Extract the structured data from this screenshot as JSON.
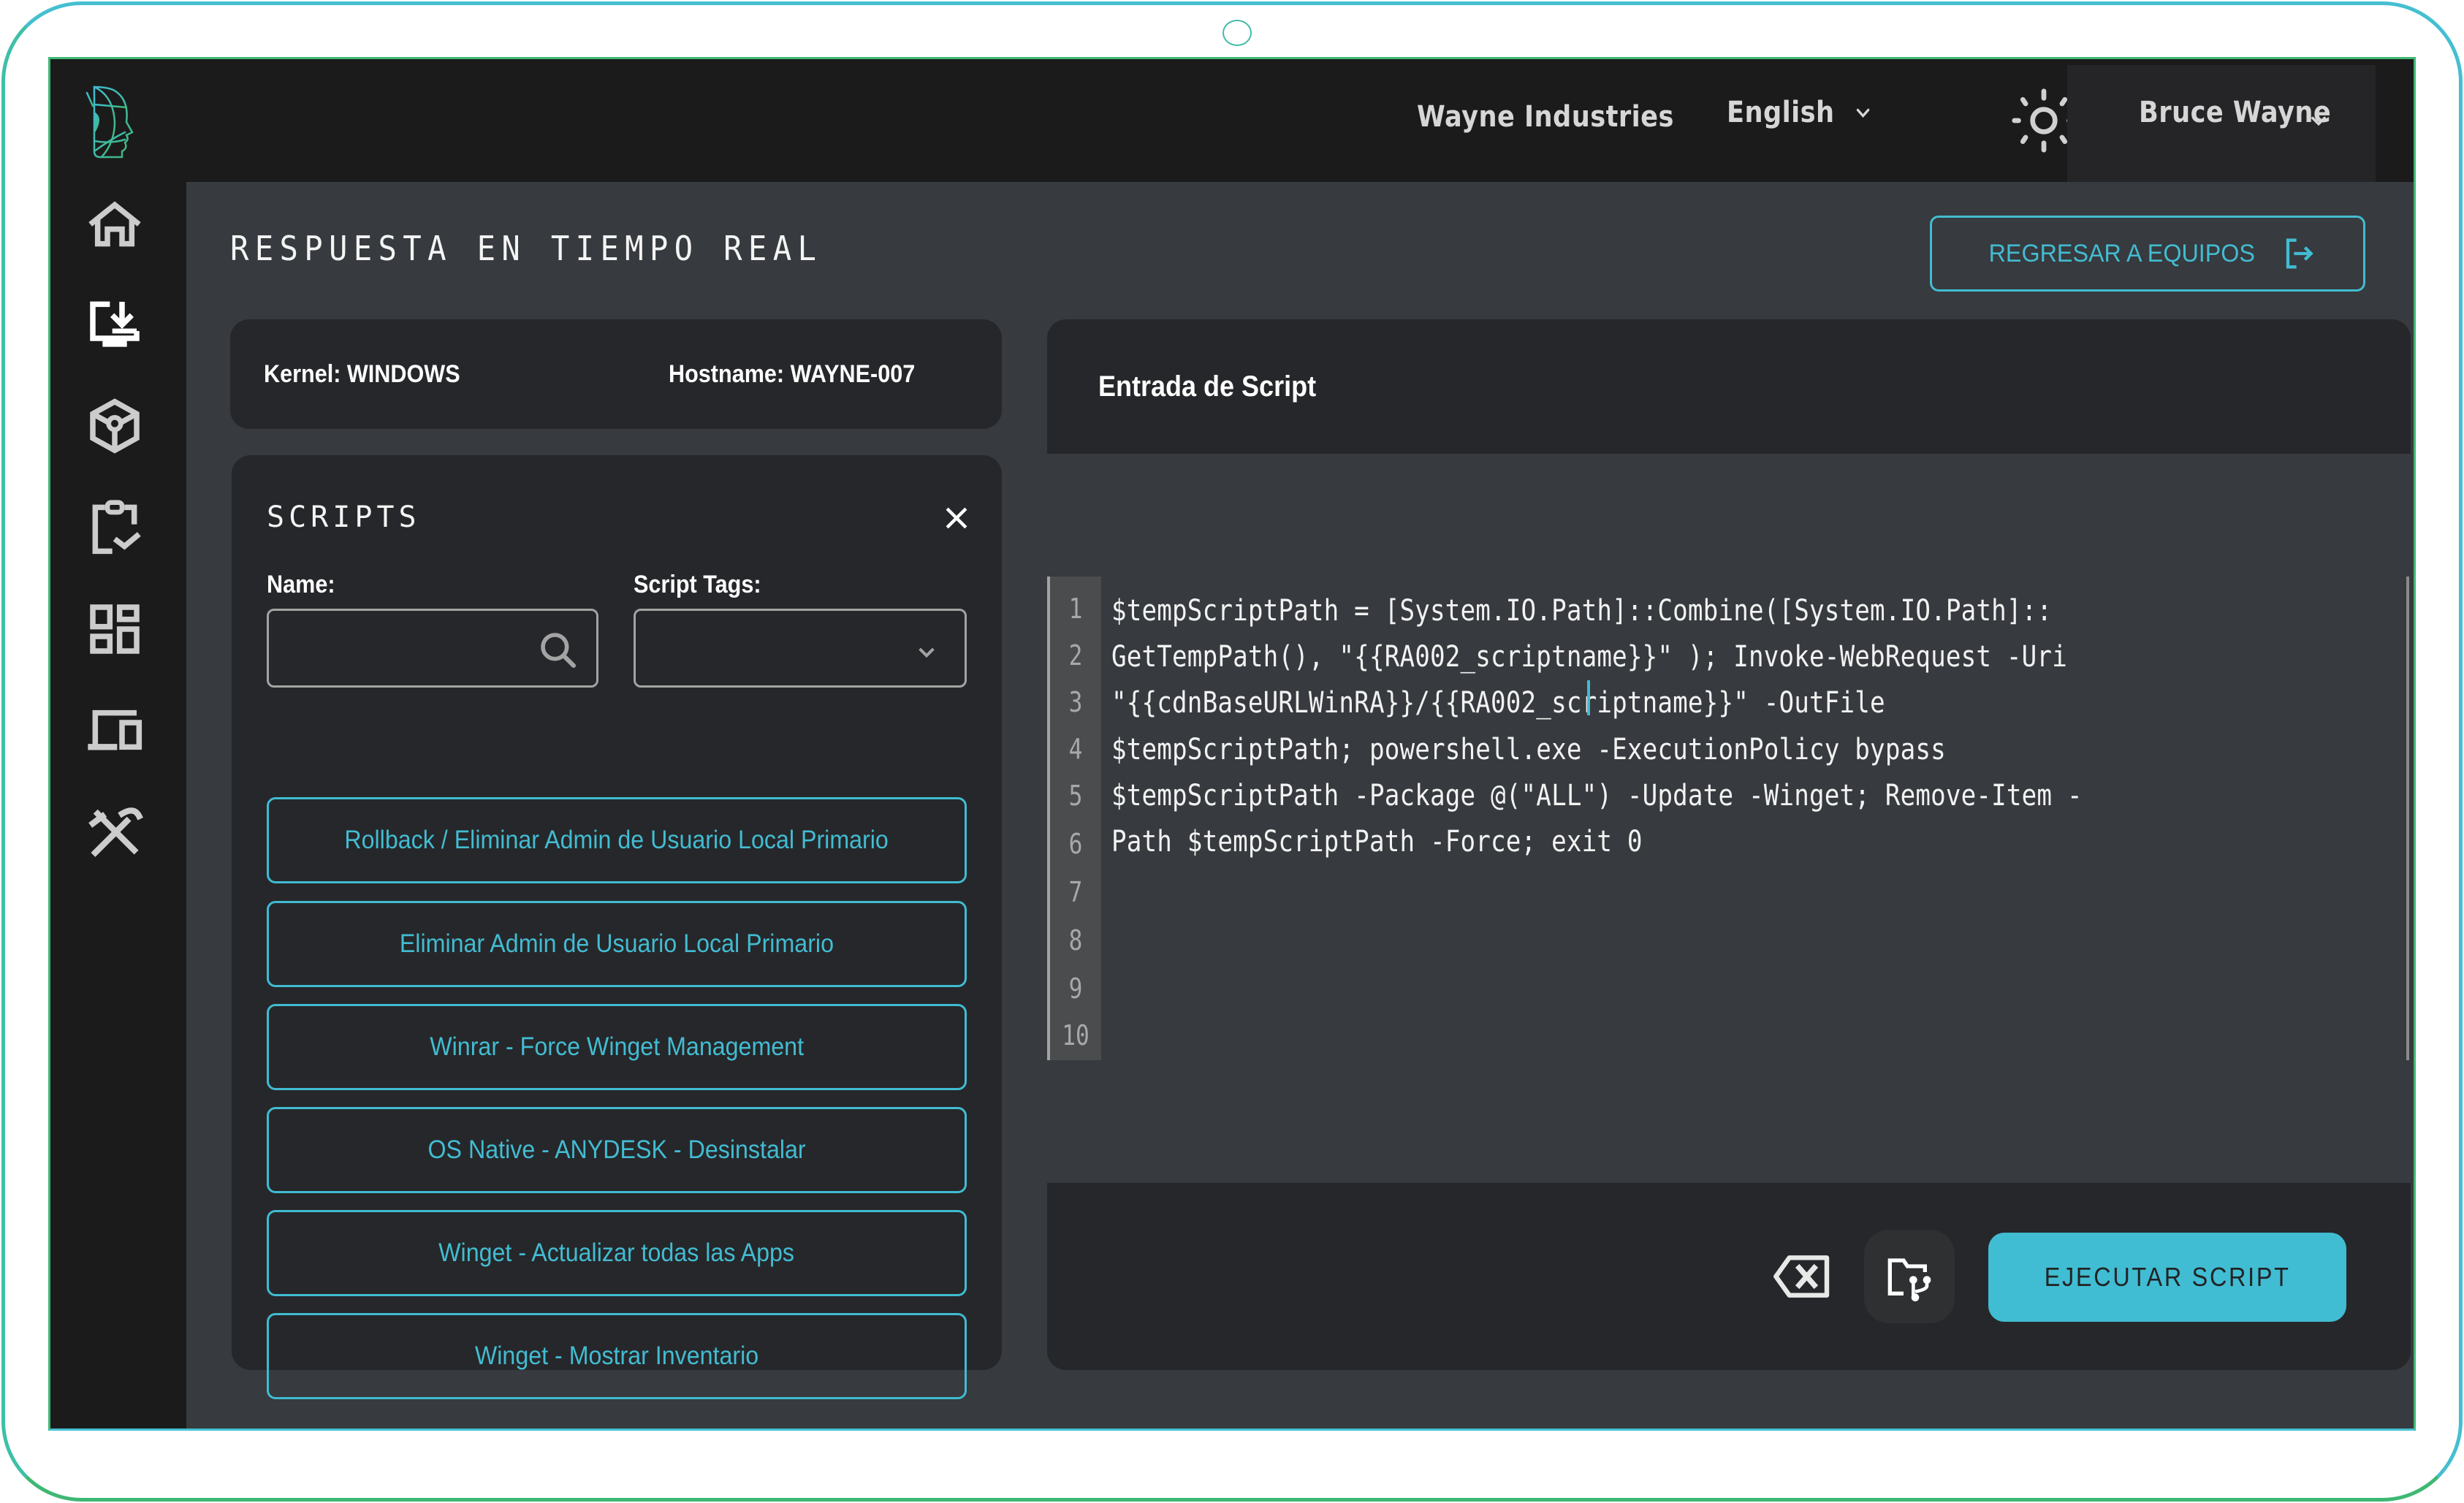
{
  "brand": {
    "logo": "face-wireframe-logo",
    "accent_color": "#42bcd2",
    "frame_gradient": [
      "#45bfd1",
      "#3fb874"
    ]
  },
  "topbar": {
    "company": "Wayne Industries",
    "language": "English",
    "theme_icon": "sun-icon",
    "user": "Bruce Wayne"
  },
  "sidebar": {
    "items": [
      {
        "name": "home",
        "icon": "home-icon",
        "active": false
      },
      {
        "name": "deploy",
        "icon": "monitor-download-icon",
        "active": true
      },
      {
        "name": "packages",
        "icon": "cube-icon",
        "active": false
      },
      {
        "name": "tasks",
        "icon": "clipboard-check-icon",
        "active": false
      },
      {
        "name": "dashboard",
        "icon": "dashboard-grid-icon",
        "active": false
      },
      {
        "name": "devices",
        "icon": "devices-icon",
        "active": false
      },
      {
        "name": "tools",
        "icon": "tools-icon",
        "active": false
      }
    ]
  },
  "page": {
    "title": "RESPUESTA EN TIEMPO REAL",
    "back_button": "REGRESAR A EQUIPOS"
  },
  "device_info": {
    "kernel": "Kernel: WINDOWS",
    "hostname": "Hostname: WAYNE-007"
  },
  "scripts_panel": {
    "title": "SCRIPTS",
    "name_label": "Name:",
    "name_value": "",
    "tags_label": "Script Tags:",
    "tags_value": "",
    "items": [
      "Rollback / Eliminar Admin de Usuario Local Primario",
      "Eliminar Admin de Usuario Local Primario",
      "Winrar - Force Winget Management",
      "OS Native - ANYDESK - Desinstalar",
      "Winget - Actualizar todas las Apps",
      "Winget - Mostrar Inventario"
    ]
  },
  "script_entry": {
    "title": "Entrada de Script",
    "line_numbers": [
      "1",
      "2",
      "3",
      "4",
      "5",
      "6",
      "7",
      "8",
      "9",
      "10"
    ],
    "lines": [
      "$tempScriptPath = [System.IO.Path]::Combine([System.IO.Path]::",
      "GetTempPath(), \"{{RA002_scriptname}}\" ); Invoke-WebRequest -Uri",
      "\"{{cdnBaseURLWinRA}}/{{RA002_scriptname}}\" -OutFile",
      "$tempScriptPath; powershell.exe -ExecutionPolicy bypass",
      "$tempScriptPath -Package @(\"ALL\") -Update -Winget; Remove-Item -",
      "Path $tempScriptPath -Force; exit 0",
      "",
      "",
      "",
      ""
    ],
    "run_button": "EJECUTAR SCRIPT"
  }
}
